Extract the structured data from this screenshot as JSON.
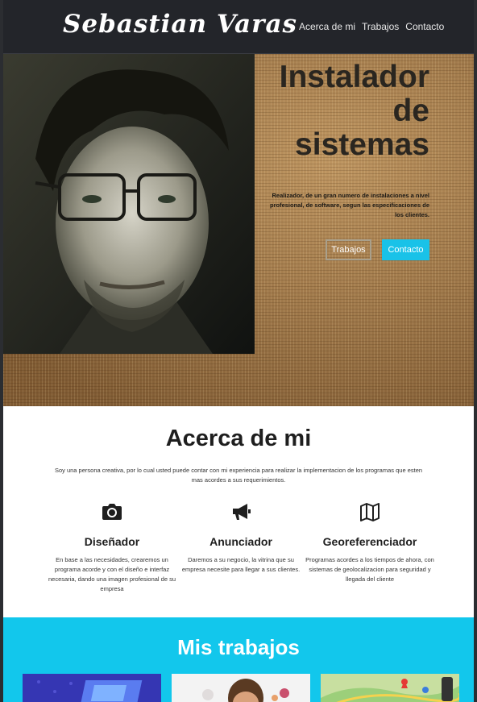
{
  "header": {
    "brand": "Sebastian Varas",
    "nav": [
      "Acerca de mi",
      "Trabajos",
      "Contacto"
    ]
  },
  "hero": {
    "title": "Instalador de sistemas",
    "description": "Realizador, de un gran numero de instalaciones a nivel profesional, de software, segun las especificaciones de los clientes.",
    "button_outline": "Trabajos",
    "button_solid": "Contacto"
  },
  "about": {
    "title": "Acerca de mi",
    "text": "Soy una persona creativa, por lo cual usted puede contar con mi experiencia para realizar la implementacion de los programas que esten mas acordes a sus requerimientos.",
    "features": [
      {
        "icon": "camera-icon",
        "name": "Diseñador",
        "desc": "En base a las necesidades, crearemos un programa acorde y con el diseño e interfaz necesaria, dando una imagen profesional de su empresa"
      },
      {
        "icon": "megaphone-icon",
        "name": "Anunciador",
        "desc": "Daremos a su negocio, la vitrina que su empresa necesite para llegar a sus clientes."
      },
      {
        "icon": "map-icon",
        "name": "Georeferenciador",
        "desc": "Programas acordes a los tiempos de ahora, con sistemas de geolocalizacion para seguridad y llegada del cliente"
      }
    ]
  },
  "works": {
    "title": "Mis trabajos"
  },
  "colors": {
    "accent": "#12c7ec",
    "navbar": "#23252a",
    "hero_burlap": "#a87d4b"
  }
}
